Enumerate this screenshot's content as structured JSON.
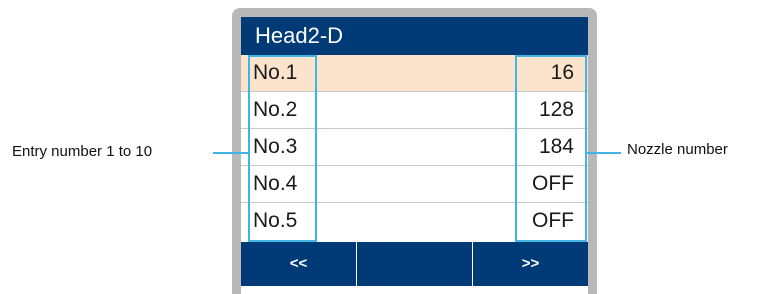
{
  "screen": {
    "title": "Head2-D",
    "rows": [
      {
        "label": "No.1",
        "value": "16",
        "selected": true
      },
      {
        "label": "No.2",
        "value": "128"
      },
      {
        "label": "No.3",
        "value": "184"
      },
      {
        "label": "No.4",
        "value": "OFF"
      },
      {
        "label": "No.5",
        "value": "OFF"
      }
    ],
    "function_keys": [
      {
        "label": "<<"
      },
      {
        "label": ""
      },
      {
        "label": ">>"
      }
    ]
  },
  "callouts": {
    "left": "Entry number 1 to 10",
    "right": "Nozzle number"
  },
  "colors": {
    "title_bar": "#003b77",
    "selected_row": "#fbe3cc",
    "highlight": "#40b4e5",
    "bezel": "#b8b8b8"
  }
}
